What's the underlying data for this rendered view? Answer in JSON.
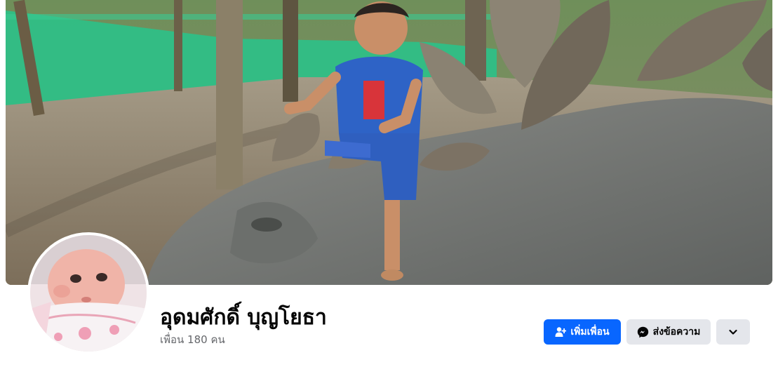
{
  "profile": {
    "name": "อุดมศักดิ์ บุญโยธา",
    "friends_text": "เพื่อน 180 คน"
  },
  "actions": {
    "add_friend_label": "เพิ่มเพื่อน",
    "message_label": "ส่งข้อความ"
  },
  "icons": {
    "add_friend": "add-friend-icon",
    "message": "messenger-icon",
    "more": "chevron-down-icon"
  },
  "colors": {
    "primary_button": "#0866ff",
    "secondary_button": "#e4e6eb",
    "name_text": "#050505",
    "secondary_text": "#65676b"
  }
}
